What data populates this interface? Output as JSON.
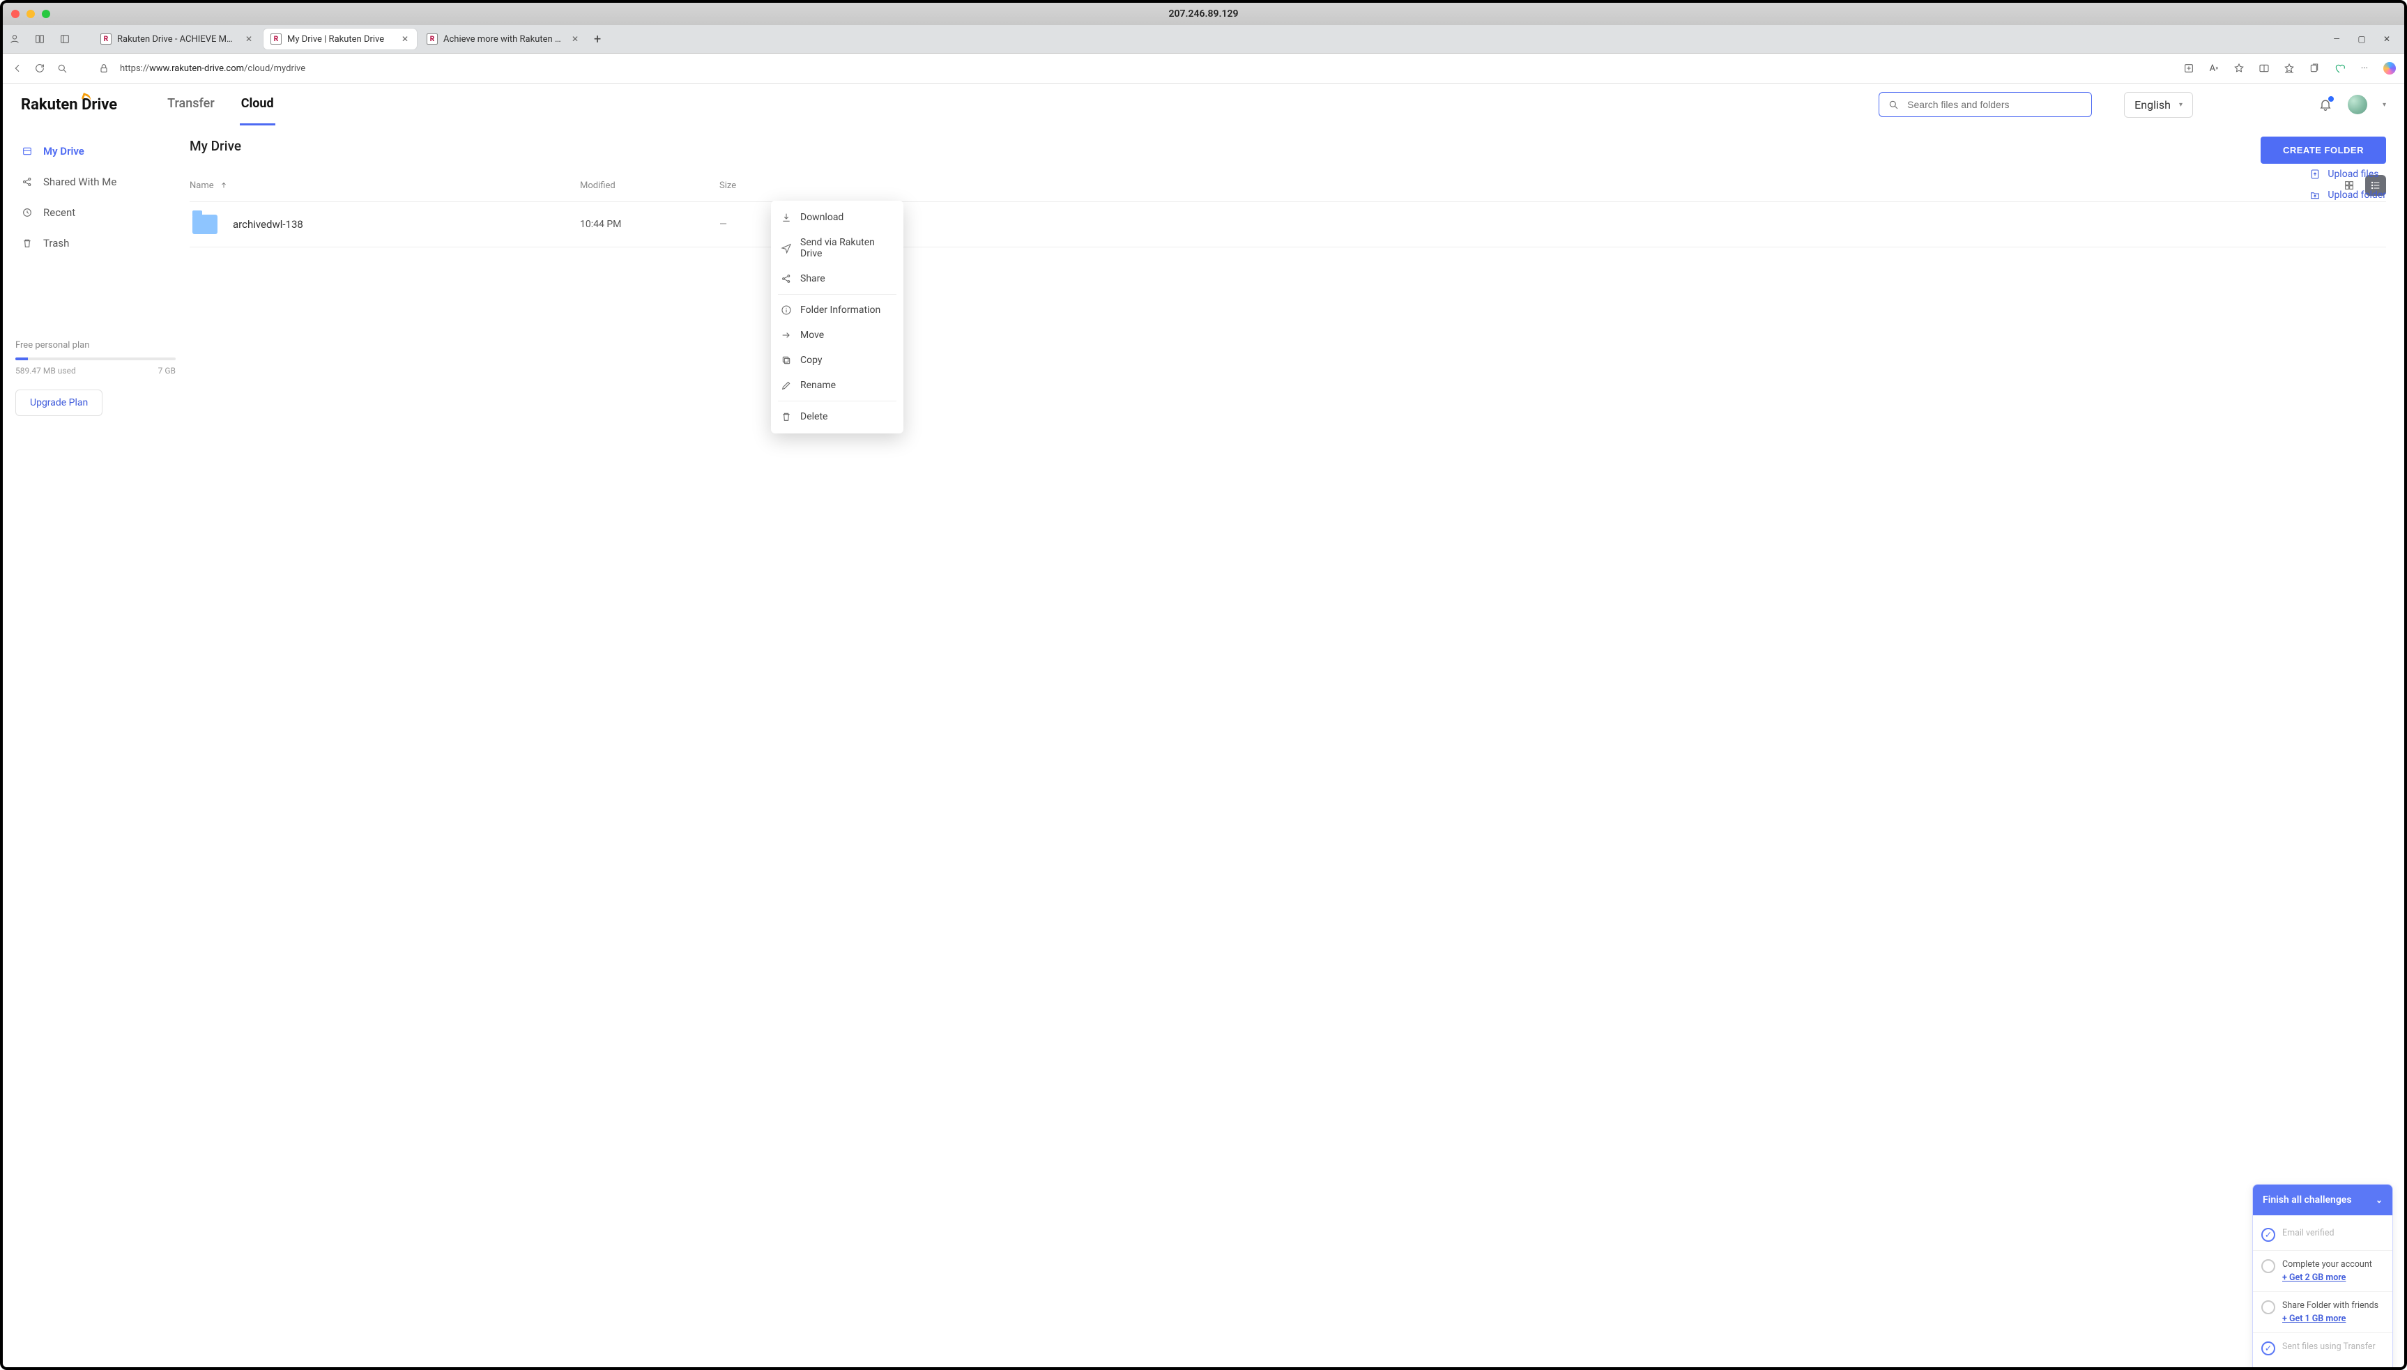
{
  "window": {
    "title": "207.246.89.129"
  },
  "browser": {
    "tabs": [
      {
        "label": "Rakuten Drive - ACHIEVE MORE"
      },
      {
        "label": "My Drive | Rakuten Drive"
      },
      {
        "label": "Achieve more with Rakuten Drive"
      }
    ],
    "url_prefix": "https://",
    "url_host": "www.rakuten-drive.com",
    "url_path": "/cloud/mydrive"
  },
  "logo": {
    "part1": "Rakuten",
    "part2": "D",
    "part3": "rive"
  },
  "nav": {
    "transfer": "Transfer",
    "cloud": "Cloud"
  },
  "search": {
    "placeholder": "Search files and folders"
  },
  "language": {
    "selected": "English"
  },
  "sidebar": {
    "items": [
      {
        "label": "My Drive"
      },
      {
        "label": "Shared With Me"
      },
      {
        "label": "Recent"
      },
      {
        "label": "Trash"
      }
    ],
    "plan": {
      "title": "Free personal plan",
      "used": "589.47 MB used",
      "total": "7 GB",
      "upgrade": "Upgrade Plan"
    }
  },
  "breadcrumb": "My Drive",
  "create_button": "CREATE FOLDER",
  "columns": {
    "name": "Name",
    "modified": "Modified",
    "size": "Size"
  },
  "uploads": {
    "files": "Upload files",
    "folder": "Upload folder"
  },
  "items": [
    {
      "name": "archivedwl-138",
      "modified": "10:44 PM",
      "size": "—"
    }
  ],
  "context_menu": {
    "download": "Download",
    "send": "Send via Rakuten Drive",
    "share": "Share",
    "info": "Folder Information",
    "move": "Move",
    "copy": "Copy",
    "rename": "Rename",
    "delete": "Delete"
  },
  "challenges": {
    "title": "Finish all challenges",
    "items": [
      {
        "label": "Email verified",
        "done": true
      },
      {
        "label": "Complete your account",
        "get": "+ Get 2 GB more",
        "done": false
      },
      {
        "label": "Share Folder with friends",
        "get": "+ Get 1 GB more",
        "done": false
      },
      {
        "label": "Sent files using Transfer",
        "done": true
      }
    ]
  }
}
